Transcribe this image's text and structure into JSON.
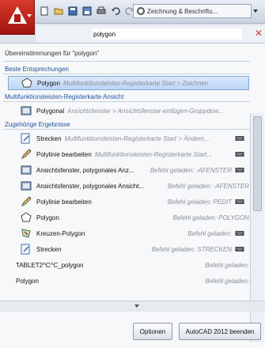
{
  "titlebar": {
    "workspace_label": "Zeichnung & Beschriftu..."
  },
  "search": {
    "value": "polygon"
  },
  "results": {
    "summary": "Übereinstimmungen für \"polygon\"",
    "sections": [
      {
        "title": "Beste Entsprechungen",
        "items": [
          {
            "icon": "polygon-icon",
            "name": "Polygon",
            "path": "Multifunktionsleisten-Registerkarte Start > Zeichnen",
            "right": "",
            "tail": "",
            "selected": true
          }
        ]
      },
      {
        "title": "Multifunktionsleisten-Registerkarte Ansicht",
        "items": [
          {
            "icon": "viewport-polygonal-icon",
            "name": "Polygonal",
            "path": "Ansichtsfenster > Ansichtsfenster-einfügen-Gruppdow...",
            "right": "",
            "tail": ""
          }
        ]
      },
      {
        "title": "Zugehörige Ergebnisse",
        "items": [
          {
            "icon": "stretch-icon",
            "name": "Strecken",
            "path": "Multifunktionsleisten-Registerkarte Start > Ändern...",
            "right": "",
            "tail": "keyboard-icon"
          },
          {
            "icon": "pedit-icon",
            "name": "Polylinie bearbeiten",
            "path": "Multifunktionsleisten-Registerkarte Start...",
            "right": "",
            "tail": "keyboard-icon"
          },
          {
            "icon": "viewport-polygonal-icon",
            "name": "Ansichtsfenster, polygonales Anz...",
            "path": "",
            "right": "Befehl geladen: -AFENSTER",
            "tail": "keyboard-icon"
          },
          {
            "icon": "viewport-polygonal-icon",
            "name": "Ansichtsfenster, polygonales Ansicht...",
            "path": "",
            "right": "Befehl geladen: -AFENSTER",
            "tail": ""
          },
          {
            "icon": "pedit-icon",
            "name": "Polylinie bearbeiten",
            "path": "",
            "right": "Befehl geladen: PEDIT",
            "tail": "keyboard-icon"
          },
          {
            "icon": "polygon-icon",
            "name": "Polygon",
            "path": "",
            "right": "Befehl geladen: POLYGON",
            "tail": ""
          },
          {
            "icon": "crossing-polygon-icon",
            "name": "Kreuzen-Polygon",
            "path": "",
            "right": "Befehl geladen:",
            "tail": "keyboard-icon"
          },
          {
            "icon": "stretch-icon",
            "name": "Strecken",
            "path": "",
            "right": "Befehl geladen: STRECKEN",
            "tail": "keyboard-icon"
          },
          {
            "icon": "",
            "name": "TABLET2^C^C_polygon",
            "path": "",
            "right": "Befehl geladen:",
            "tail": ""
          },
          {
            "icon": "",
            "name": "Polygon",
            "path": "",
            "right": "Befehl geladen:",
            "tail": ""
          }
        ]
      }
    ]
  },
  "footer": {
    "options_label": "Optionen",
    "browse_label": "AutoCAD 2012 beenden"
  },
  "colors": {
    "accent": "#2152a8",
    "app_red": "#c0251b",
    "selection": "#bcd6f5"
  }
}
